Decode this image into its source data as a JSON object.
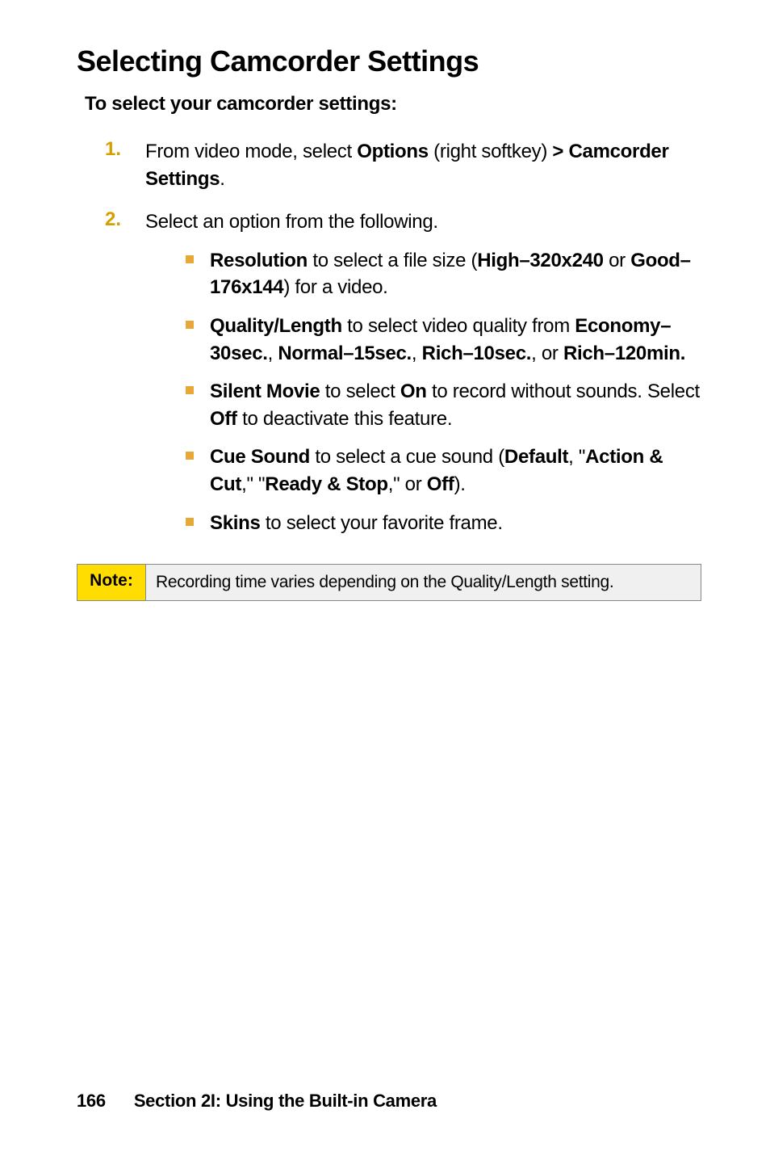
{
  "heading": "Selecting Camcorder Settings",
  "subheading": "To select your camcorder settings:",
  "steps": [
    {
      "number": "1.",
      "before": "From video mode, select ",
      "bold1": "Options",
      "mid1": " (right softkey) ",
      "bold2": "> Camcorder Settings",
      "after": "."
    },
    {
      "number": "2.",
      "text": "Select an option from the following."
    }
  ],
  "sub": {
    "resolution": {
      "b1": "Resolution",
      "t1": " to select a file size (",
      "b2": "High–320x240",
      "t2": " or ",
      "b3": "Good–176x144",
      "t3": ") for a video."
    },
    "quality": {
      "b1": "Quality/Length",
      "t1": " to select video quality from ",
      "b2": "Economy–30sec.",
      "t2": ", ",
      "b3": "Normal–15sec.",
      "t3": ", ",
      "b4": "Rich–10sec.",
      "t4": ", or ",
      "b5": "Rich–120min."
    },
    "silent": {
      "b1": "Silent Movie",
      "t1": " to select ",
      "b2": "On",
      "t2": " to record without sounds. Select ",
      "b3": "Off",
      "t3": " to deactivate this feature."
    },
    "cue": {
      "b1": "Cue Sound",
      "t1": " to select a cue sound (",
      "b2": "Default",
      "t2": ", \"",
      "b3": "Action & Cut",
      "t3": ",\" \"",
      "b4": "Ready & Stop",
      "t4": ",\" or ",
      "b5": "Off",
      "t5": ")."
    },
    "skins": {
      "b1": "Skins",
      "t1": " to select your favorite frame."
    }
  },
  "note": {
    "label": "Note:",
    "text": "Recording time varies depending on the Quality/Length setting."
  },
  "footer": {
    "page": "166",
    "section": "Section 2I: Using the Built-in Camera"
  }
}
